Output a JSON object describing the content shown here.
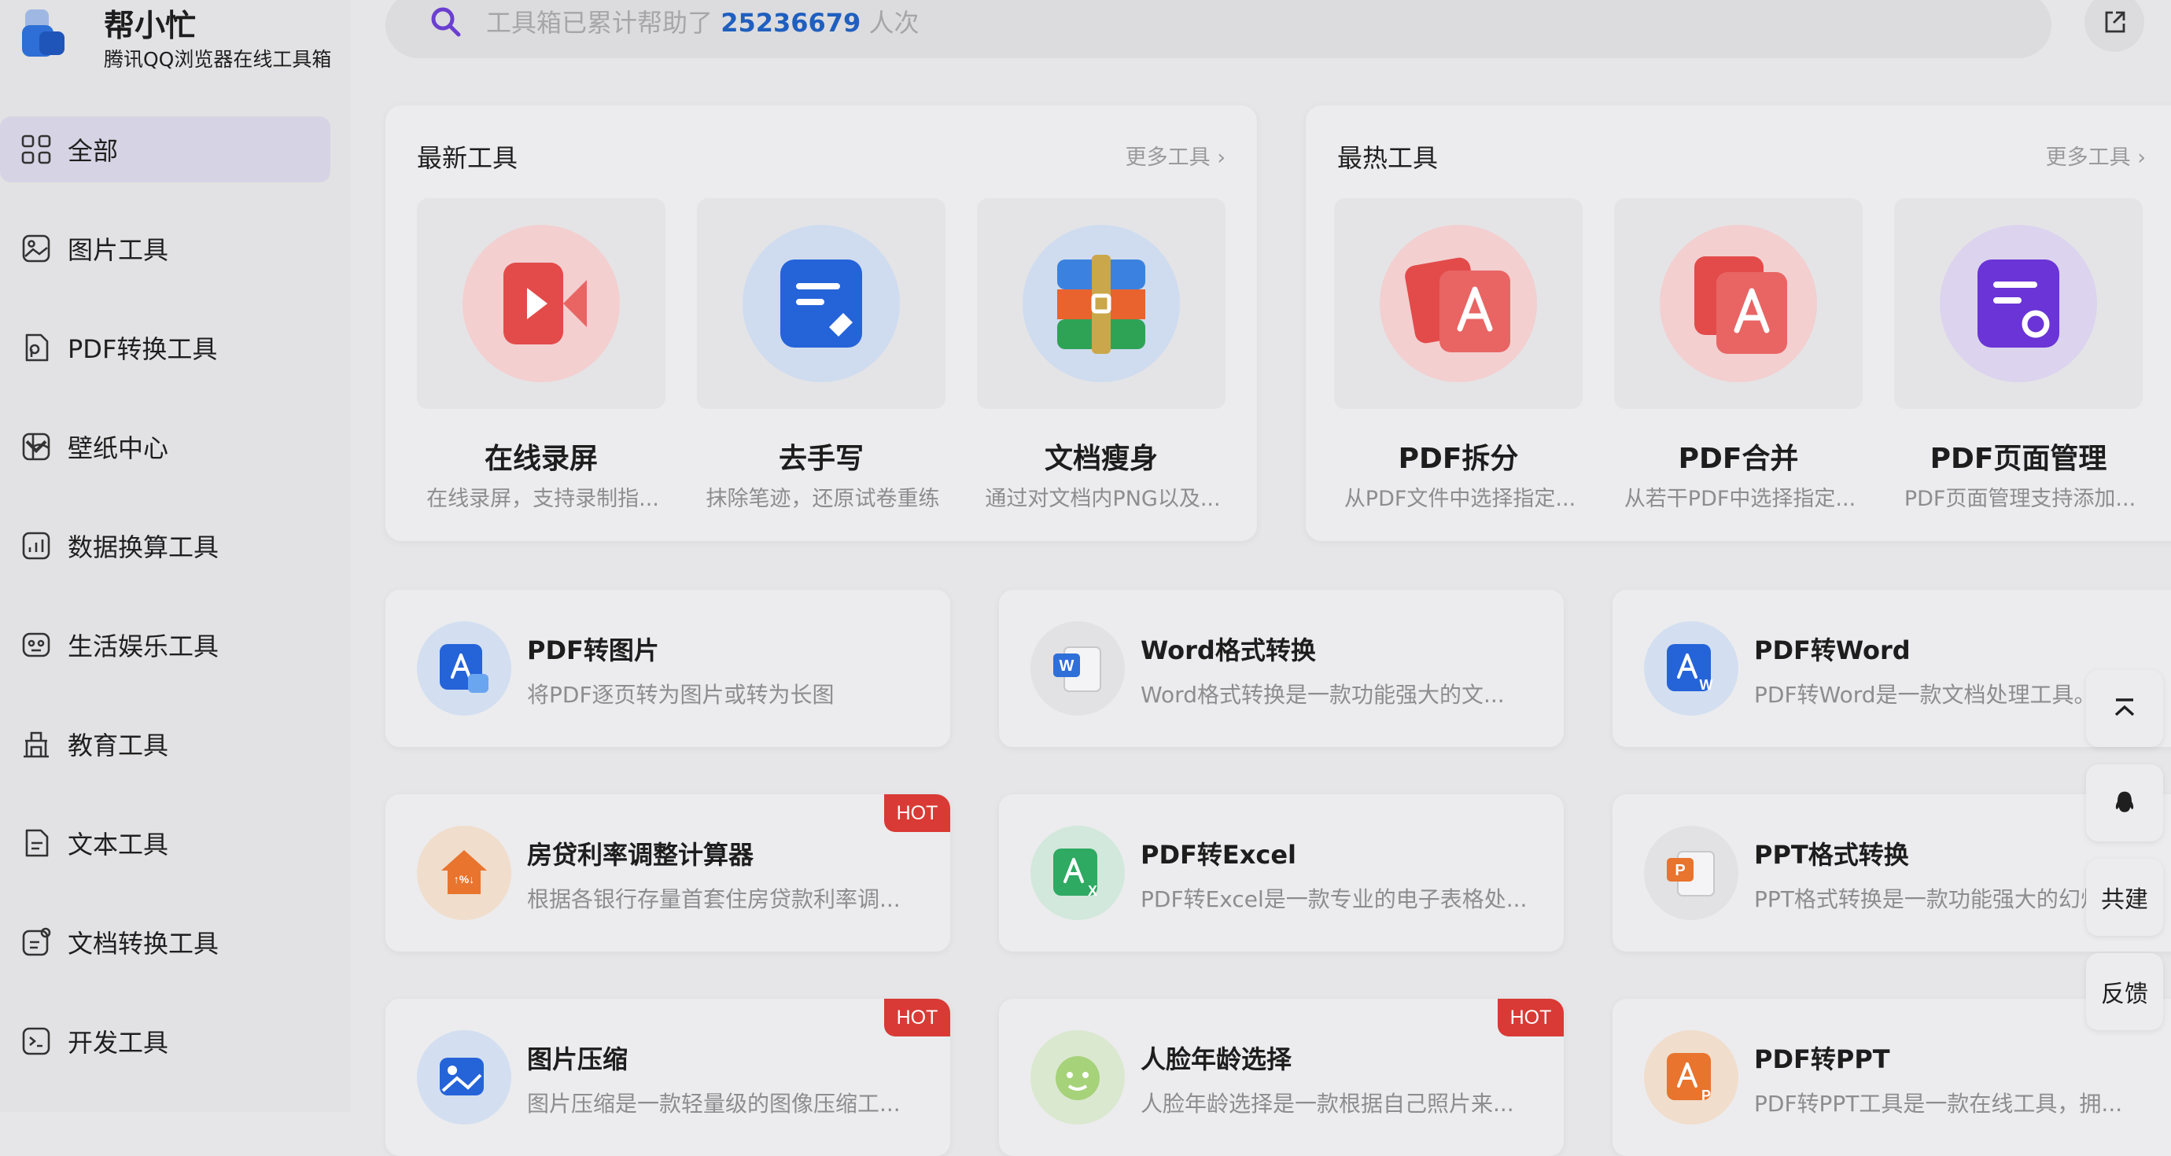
{
  "brand": {
    "name": "帮小忙",
    "subtitle": "腾讯QQ浏览器在线工具箱"
  },
  "sidebar": {
    "items": [
      {
        "label": "全部",
        "icon": "grid-icon",
        "active": true
      },
      {
        "label": "图片工具",
        "icon": "image-icon"
      },
      {
        "label": "PDF转换工具",
        "icon": "pdf-icon"
      },
      {
        "label": "壁纸中心",
        "icon": "wallpaper-icon",
        "expandable": true
      },
      {
        "label": "数据换算工具",
        "icon": "chart-icon"
      },
      {
        "label": "生活娱乐工具",
        "icon": "gamepad-icon"
      },
      {
        "label": "教育工具",
        "icon": "education-icon"
      },
      {
        "label": "文本工具",
        "icon": "text-icon"
      },
      {
        "label": "文档转换工具",
        "icon": "document-convert-icon"
      },
      {
        "label": "开发工具",
        "icon": "code-icon"
      }
    ]
  },
  "search": {
    "prefix": "工具箱已累计帮助了",
    "count": "25236679",
    "suffix": "人次"
  },
  "newest": {
    "title": "最新工具",
    "more": "更多工具",
    "tools": [
      {
        "name": "在线录屏",
        "desc": "在线录屏，支持录制指...",
        "icon": "screen-record-icon",
        "color": "#f3cfd0"
      },
      {
        "name": "去手写",
        "desc": "抹除笔迹，还原试卷重练",
        "icon": "erase-handwriting-icon",
        "color": "#cfdcef"
      },
      {
        "name": "文档瘦身",
        "desc": "通过对文档内PNG以及...",
        "icon": "compress-doc-icon",
        "color": "#cfdcef"
      }
    ]
  },
  "hottest": {
    "title": "最热工具",
    "more": "更多工具",
    "tools": [
      {
        "name": "PDF拆分",
        "desc": "从PDF文件中选择指定...",
        "icon": "pdf-split-icon",
        "color": "#f3cfd0"
      },
      {
        "name": "PDF合并",
        "desc": "从若干PDF中选择指定...",
        "icon": "pdf-merge-icon",
        "color": "#f3cfd0"
      },
      {
        "name": "PDF页面管理",
        "desc": "PDF页面管理支持添加...",
        "icon": "pdf-page-manage-icon",
        "color": "#dcd3ee"
      }
    ]
  },
  "cards": [
    {
      "title": "PDF转图片",
      "desc": "将PDF逐页转为图片或转为长图",
      "icon": "pdf-to-image-icon",
      "bg": "#d3dff0",
      "hot": false
    },
    {
      "title": "Word格式转换",
      "desc": "Word格式转换是一款功能强大的文...",
      "icon": "word-convert-icon",
      "bg": "#e2e2e4",
      "hot": false
    },
    {
      "title": "PDF转Word",
      "desc": "PDF转Word是一款文档处理工具。",
      "icon": "pdf-to-word-icon",
      "bg": "#d3dff0",
      "hot": false
    },
    {
      "title": "房贷利率调整计算器",
      "desc": "根据各银行存量首套住房贷款利率调...",
      "icon": "mortgage-calc-icon",
      "bg": "#f0ddcc",
      "hot": true
    },
    {
      "title": "PDF转Excel",
      "desc": "PDF转Excel是一款专业的电子表格处...",
      "icon": "pdf-to-excel-icon",
      "bg": "#d3e8dc",
      "hot": false
    },
    {
      "title": "PPT格式转换",
      "desc": "PPT格式转换是一款功能强大的幻灯...",
      "icon": "ppt-convert-icon",
      "bg": "#e2e2e4",
      "hot": false
    },
    {
      "title": "图片压缩",
      "desc": "图片压缩是一款轻量级的图像压缩工...",
      "icon": "image-compress-icon",
      "bg": "#d3dff0",
      "hot": true
    },
    {
      "title": "人脸年龄选择",
      "desc": "人脸年龄选择是一款根据自己照片来...",
      "icon": "face-age-icon",
      "bg": "#dbe8d0",
      "hot": true
    },
    {
      "title": "PDF转PPT",
      "desc": "PDF转PPT工具是一款在线工具，拥...",
      "icon": "pdf-to-ppt-icon",
      "bg": "#f0ddcc",
      "hot": false
    }
  ],
  "hot_label": "HOT",
  "float": {
    "build": "共建",
    "feedback": "反馈"
  }
}
